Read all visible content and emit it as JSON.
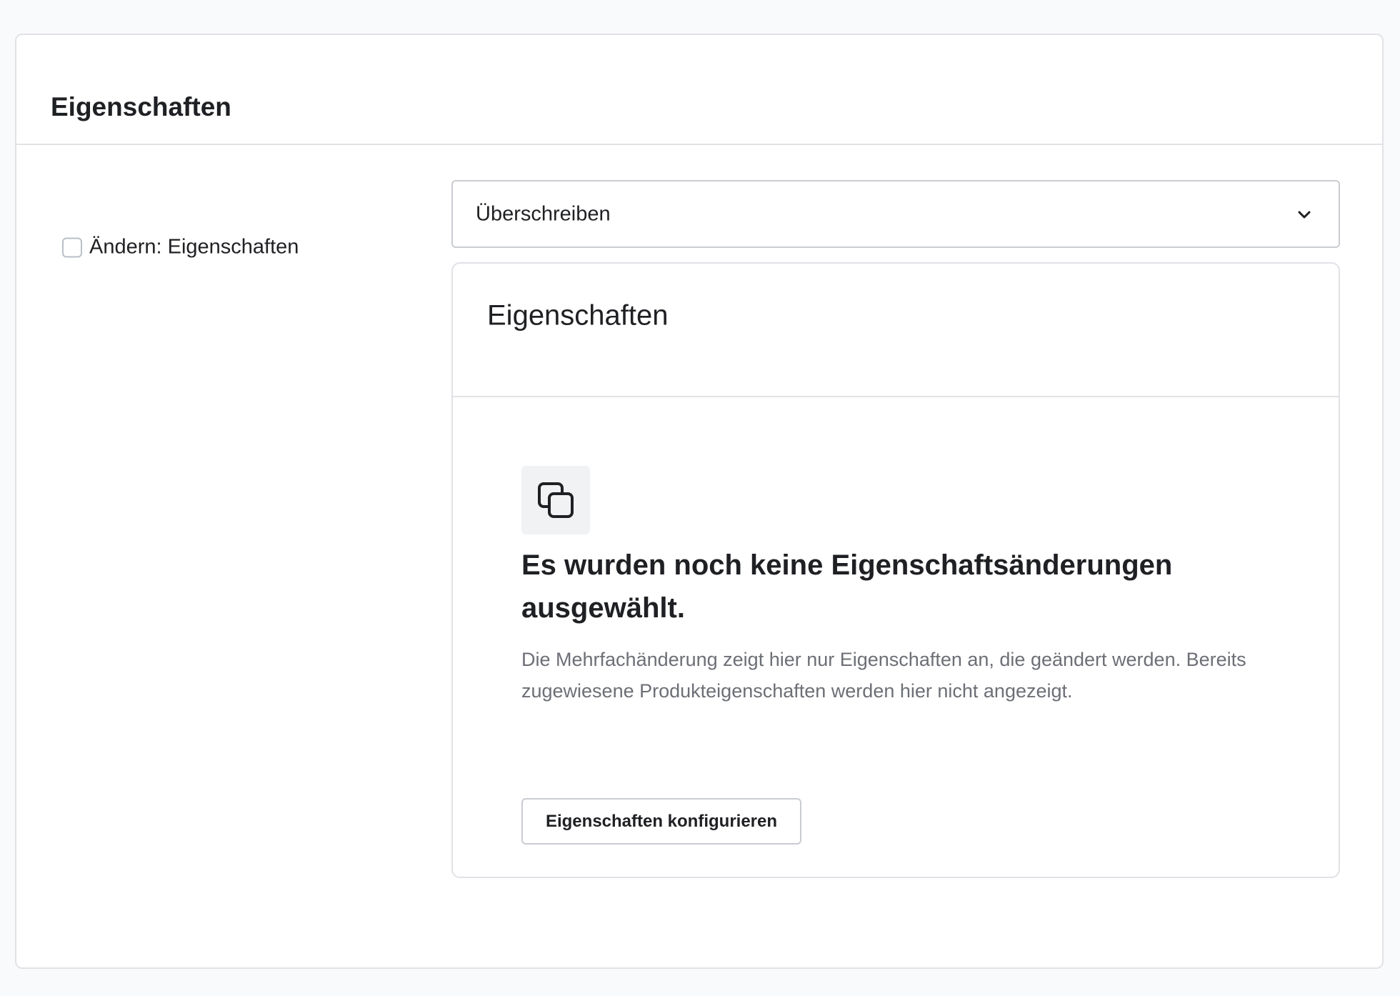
{
  "card": {
    "title": "Eigenschaften"
  },
  "toggle": {
    "label": "Ändern: Eigenschaften",
    "checked": false
  },
  "mode_select": {
    "value": "Überschreiben",
    "icon": "chevron-down-icon"
  },
  "properties_panel": {
    "title": "Eigenschaften",
    "empty_state": {
      "icon": "copy-icon",
      "title": "Es wurden noch keine Eigenschaftsänderungen ausgewählt.",
      "description": "Die Mehrfachänderung zeigt hier nur Eigenschaften an, die geändert werden. Bereits zugewiesene Produkteigenschaften werden hier nicht angezeigt.",
      "button_label": "Eigenschaften konfigurieren"
    }
  },
  "colors": {
    "background": "#f9fafb",
    "card": "#ffffff",
    "border": "#e0e2e6",
    "text": "#1f2023",
    "muted_text": "#6c6f75",
    "icon_background": "#f0f2f4"
  }
}
